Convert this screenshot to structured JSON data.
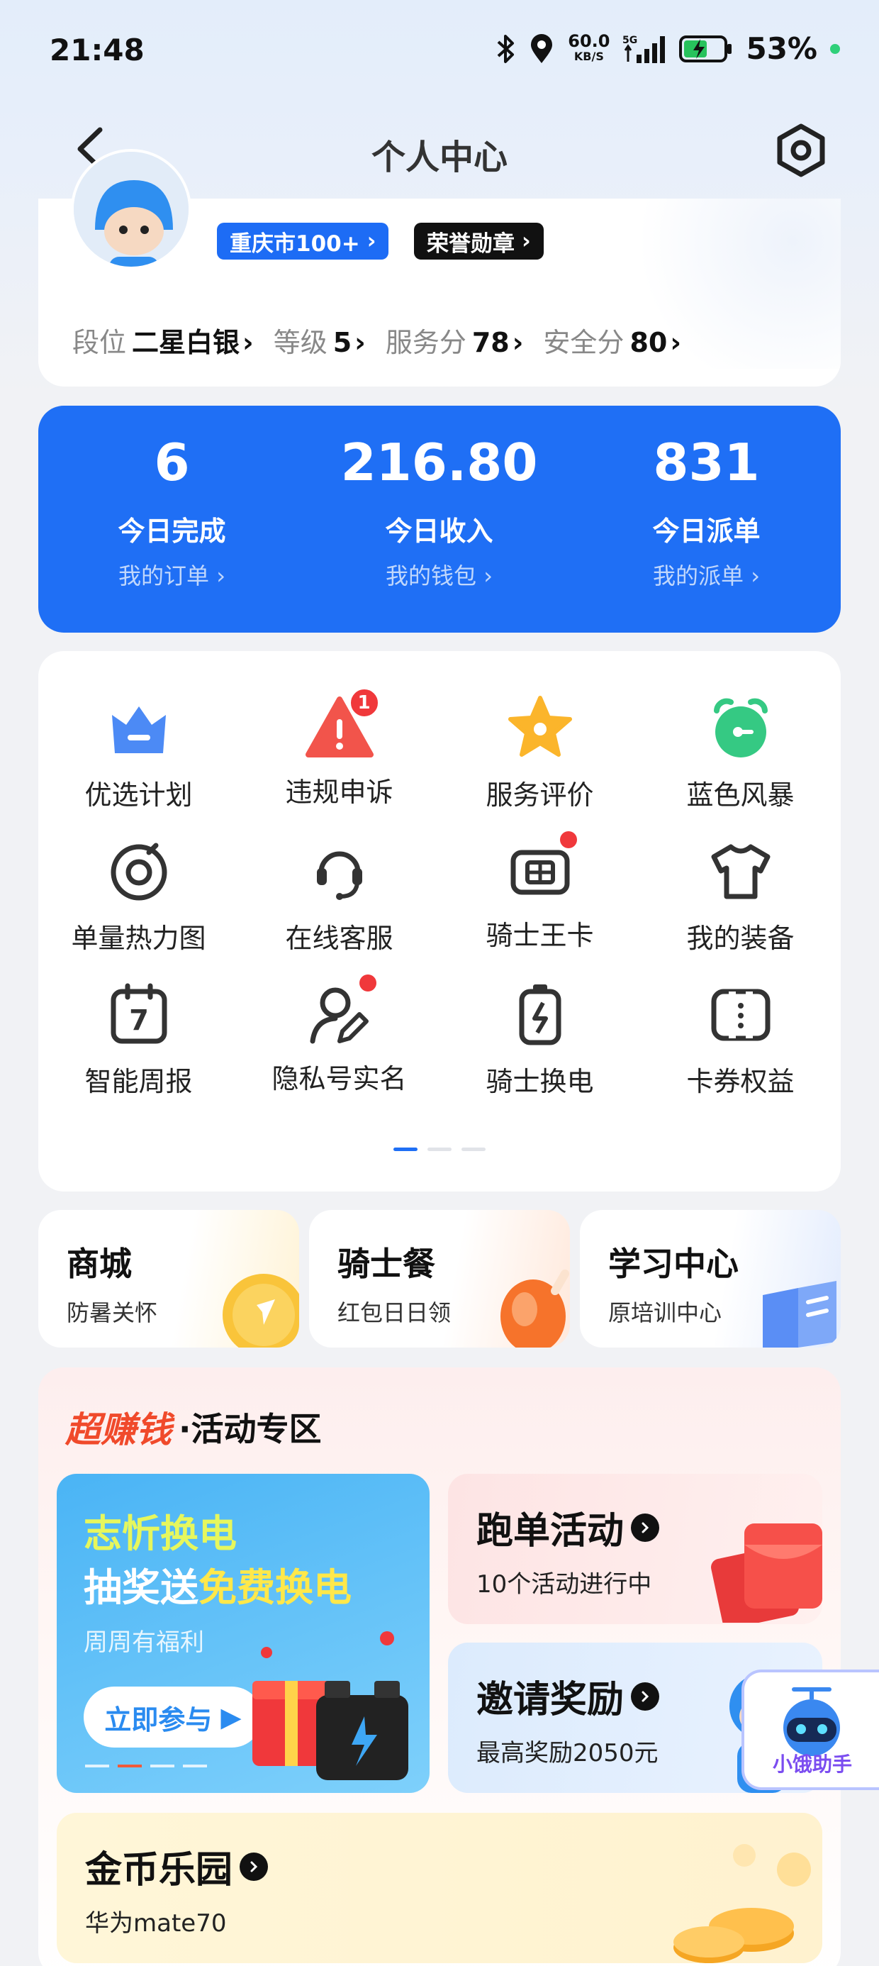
{
  "status_bar": {
    "time": "21:48",
    "speed_value": "60.0",
    "speed_unit": "KB/S",
    "network": "5G",
    "battery": "53%"
  },
  "nav": {
    "title": "个人中心"
  },
  "profile": {
    "city_badge": "重庆市100+",
    "medal_badge": "荣誉勋章",
    "stats": [
      {
        "label": "段位",
        "value": "二星白银"
      },
      {
        "label": "等级",
        "value": "5"
      },
      {
        "label": "服务分",
        "value": "78"
      },
      {
        "label": "安全分",
        "value": "80"
      }
    ]
  },
  "summary": [
    {
      "value": "6",
      "label": "今日完成",
      "link": "我的订单"
    },
    {
      "value": "216.80",
      "label": "今日收入",
      "link": "我的钱包"
    },
    {
      "value": "831",
      "label": "今日派单",
      "link": "我的派单"
    }
  ],
  "grid": [
    {
      "label": "优选计划",
      "icon": "crown-icon"
    },
    {
      "label": "违规申诉",
      "icon": "warning-icon",
      "badge": "1"
    },
    {
      "label": "服务评价",
      "icon": "star-icon"
    },
    {
      "label": "蓝色风暴",
      "icon": "alarm-clock-icon"
    },
    {
      "label": "单量热力图",
      "icon": "target-icon"
    },
    {
      "label": "在线客服",
      "icon": "headset-icon"
    },
    {
      "label": "骑士王卡",
      "icon": "sim-card-icon"
    },
    {
      "label": "我的装备",
      "icon": "tshirt-icon"
    },
    {
      "label": "智能周报",
      "icon": "calendar-icon",
      "calendar_day": "7"
    },
    {
      "label": "隐私号实名",
      "icon": "user-edit-icon"
    },
    {
      "label": "骑士换电",
      "icon": "battery-swap-icon"
    },
    {
      "label": "卡券权益",
      "icon": "coupon-icon"
    }
  ],
  "quick_cards": [
    {
      "title": "商城",
      "subtitle": "防暑关怀"
    },
    {
      "title": "骑士餐",
      "subtitle": "红包日日领"
    },
    {
      "title": "学习中心",
      "subtitle": "原培训中心"
    }
  ],
  "activity": {
    "brand": "超赚钱",
    "title": "·活动专区",
    "promo": {
      "line1": "志忻换电",
      "line2_prefix": "抽奖送",
      "line2_highlight": "免费换电",
      "subtitle": "周周有福利",
      "button": "立即参与"
    },
    "run_activity": {
      "title": "跑单活动",
      "subtitle": "10个活动进行中"
    },
    "invite": {
      "title": "邀请奖励",
      "subtitle": "最高奖励2050元"
    },
    "coins": {
      "title": "金币乐园",
      "subtitle": "华为mate70"
    }
  },
  "assistant": {
    "label": "小饿助手"
  },
  "colors": {
    "primary_blue": "#1f6ff5",
    "badge_red": "#f0383b",
    "brand_red": "#f04a2b"
  }
}
